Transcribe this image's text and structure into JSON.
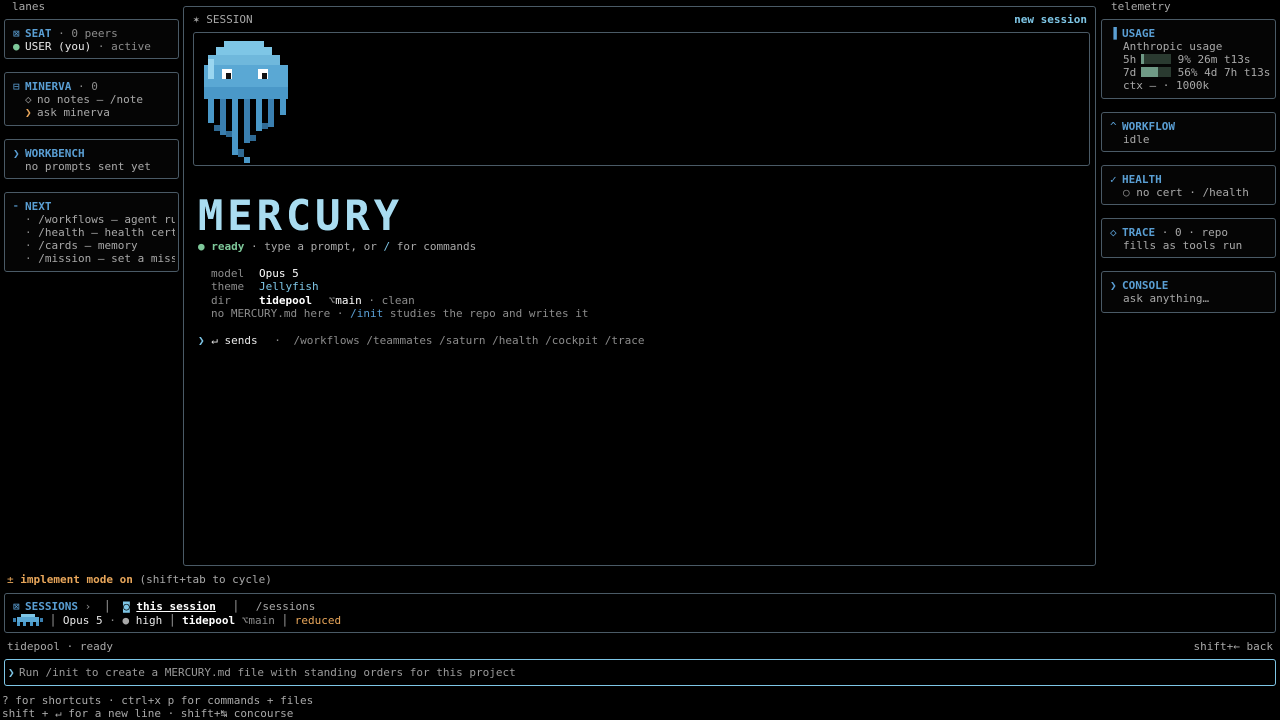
{
  "lanes_label": "lanes",
  "telemetry_label": "telemetry",
  "left": {
    "seat": {
      "title": "SEAT",
      "meta": "· 0 peers",
      "user": "USER (you)",
      "status": "· active"
    },
    "minerva": {
      "title": "MINERVA",
      "meta": "· 0",
      "line1": "no notes — /note",
      "line2": "ask minerva"
    },
    "workbench": {
      "title": "WORKBENCH",
      "line1": "no prompts sent yet"
    },
    "next": {
      "title": "NEXT",
      "items": [
        "/workflows — agent ru…",
        "/health — health cert",
        "/cards — memory",
        "/mission — set a miss…"
      ]
    }
  },
  "session": {
    "label": "SESSION",
    "new_session": "new session",
    "logo_word": "MERCURY",
    "ready": "ready",
    "ready_hint_pre": "· type a prompt, or",
    "ready_slash": "/",
    "ready_hint_post": "for commands",
    "info": {
      "model_key": "model",
      "model_val": "Opus 5",
      "theme_key": "theme",
      "theme_val": "Jellyfish",
      "dir_key": "dir",
      "dir_val": "tidepool",
      "branch": "main",
      "branch_state": "· clean",
      "init_pre": "no MERCURY.md here ·",
      "init_cmd": "/init",
      "init_post": "studies the repo and writes it"
    },
    "sends_label": "↵ sends",
    "sends_cmds": "/workflows /teammates /saturn /health /cockpit /trace"
  },
  "right": {
    "usage": {
      "title": "USAGE",
      "sub": "Anthropic usage",
      "row5h_key": "5h",
      "row5h_val": "9% 26m t13s",
      "row5h_fill": 0.09,
      "row7d_key": "7d",
      "row7d_val": "56% 4d 7h t13s",
      "row7d_fill": 0.56,
      "ctx": "ctx — · 1000k"
    },
    "workflow": {
      "title": "WORKFLOW",
      "line1": "idle"
    },
    "health": {
      "title": "HEALTH",
      "line1": "no cert · /health"
    },
    "trace": {
      "title": "TRACE",
      "meta": "· 0 · repo",
      "line1": "fills as tools run"
    },
    "console": {
      "title": "CONSOLE",
      "line1": "ask anything…"
    }
  },
  "mode": {
    "label": "implement mode on",
    "hint": "(shift+tab to cycle)"
  },
  "sessions": {
    "title": "SESSIONS",
    "this_session": "this session",
    "all_sessions": "/sessions",
    "model": "Opus 5",
    "effort": "high",
    "dir": "tidepool",
    "branch": "main",
    "motion": "reduced"
  },
  "status": {
    "left": "tidepool · ready",
    "right": "shift+← back"
  },
  "input": {
    "placeholder": "Run /init to create a MERCURY.md file with standing orders for this project"
  },
  "footer": {
    "line1": "? for shortcuts · ctrl+x p for commands + files",
    "line2": "shift + ↵ for a new line · shift+↹ concourse"
  },
  "colors": {
    "accent": "#7ec6e6",
    "title_blue": "#5a9fd4",
    "ready_green": "#7ec89a",
    "mode_orange": "#e8a65a",
    "border": "#4a5a66"
  }
}
